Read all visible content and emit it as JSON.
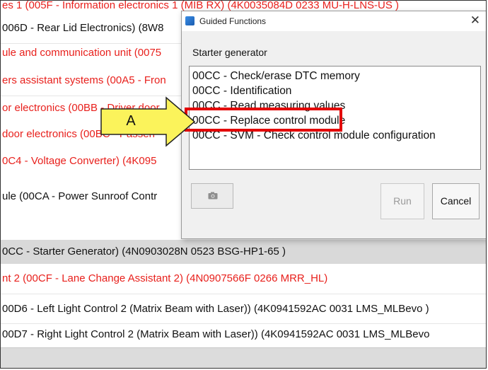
{
  "background_rows": [
    {
      "text": "es 1 (005F - Information electronics 1 (MIB RX) (4K0035084D    0233   MU-H-LNS-US )",
      "color": "red"
    },
    {
      "text": "006D - Rear Lid Electronics) (8W8",
      "color": "black"
    },
    {
      "text": "ule and communication unit (0075",
      "color": "red"
    },
    {
      "text": "ers assistant systems (00A5 - Fron",
      "color": "red"
    },
    {
      "text": "or electronics (00BB - Driver door",
      "color": "red"
    },
    {
      "text": "door electronics (00BC - Passen",
      "color": "red"
    },
    {
      "text": "0C4 - Voltage Converter) (4K095",
      "color": "red"
    },
    {
      "text": "ule (00CA - Power Sunroof Contr",
      "color": "black"
    },
    {
      "text": "0CC - Starter Generator) (4N0903028N    0523   BSG-HP1-65  )",
      "color": "black",
      "selected": true
    },
    {
      "text": "nt 2 (00CF - Lane Change Assistant 2) (4N0907566F    0266   MRR_HL)",
      "color": "red"
    },
    {
      "text": "00D6 - Left Light Control 2 (Matrix Beam with Laser)) (4K0941592AC   0031   LMS_MLBevo  )",
      "color": "black"
    },
    {
      "text": "00D7 - Right Light Control 2 (Matrix Beam with Laser)) (4K0941592AC   0031   LMS_MLBevo",
      "color": "black"
    }
  ],
  "dialog": {
    "title": "Guided Functions",
    "close_symbol": "✕",
    "heading": "Starter generator",
    "functions": [
      "00CC - Check/erase DTC memory",
      "00CC - Identification",
      "00CC - Read measuring values",
      "00CC - Replace control module",
      "00CC - SVM - Check control module configuration"
    ],
    "highlighted_function_index": 3,
    "toolbar_icon": "camera-icon",
    "run_label": "Run",
    "cancel_label": "Cancel"
  },
  "callout": {
    "label": "A",
    "color": "#fbf35b"
  },
  "colors": {
    "highlight": "#e30000",
    "red_text": "#e8201c",
    "selected_row": "#d9d9d9"
  }
}
